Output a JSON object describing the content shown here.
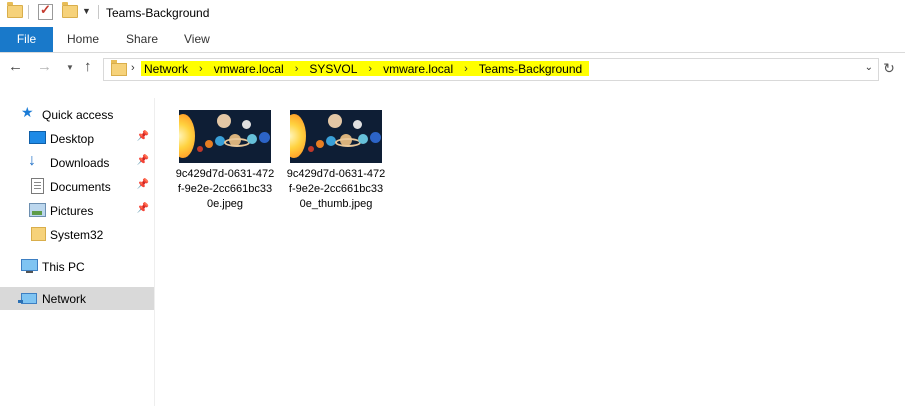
{
  "window": {
    "title": "Teams-Background"
  },
  "ribbon": {
    "file_label": "File",
    "tabs": [
      "Home",
      "Share",
      "View"
    ]
  },
  "address": {
    "crumbs": [
      "Network",
      "vmware.local",
      "SYSVOL",
      "vmware.local",
      "Teams-Background"
    ],
    "highlight_color": "#ffff00"
  },
  "sidebar": {
    "quick_access": "Quick access",
    "items": [
      "Desktop",
      "Downloads",
      "Documents",
      "Pictures",
      "System32"
    ],
    "this_pc": "This PC",
    "network": "Network"
  },
  "files": [
    {
      "name": "9c429d7d-0631-472f-9e2e-2cc661bc330e.jpeg",
      "thumbnail": "solar-system-image"
    },
    {
      "name": "9c429d7d-0631-472f-9e2e-2cc661bc330e_thumb.jpeg",
      "thumbnail": "solar-system-image"
    }
  ],
  "colors": {
    "accent": "#1979ca",
    "selection": "#d9d9d9"
  }
}
